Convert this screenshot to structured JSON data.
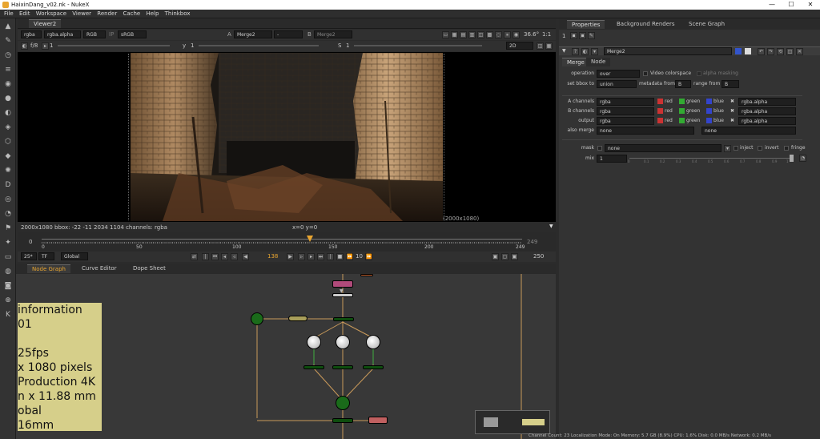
{
  "window": {
    "title": "HaixinDang_v02.nk - NukeX",
    "min": "—",
    "max": "☐",
    "close": "✕"
  },
  "menu": [
    "File",
    "Edit",
    "Workspace",
    "Viewer",
    "Render",
    "Cache",
    "Help",
    "Thinkbox"
  ],
  "viewer": {
    "tab": "Viewer2",
    "channels": "rgba",
    "alpha": "rgba.alpha",
    "colorspace": "RGB",
    "ip": "IP",
    "lut": "sRGB",
    "a_label": "A",
    "a_input": "Merge2",
    "dash": "-",
    "b_label": "B",
    "b_input": "Merge2",
    "zoom": "36.6°",
    "ratio": "1:1",
    "frame_label": "f/8",
    "frame_num": "1",
    "y_label": "y",
    "y_val": "1",
    "s_label": "S",
    "s_val": "1",
    "view_mode": "2D",
    "info": "2000x1080  bbox: -22 -11 2034 1104 channels: rgba",
    "coords": "x=0 y=0",
    "format": "(2000x1080)"
  },
  "timeline": {
    "start": "0",
    "end": "249",
    "ticks": [
      "0",
      "50",
      "100",
      "150",
      "200",
      "249"
    ],
    "current": "138",
    "fps": "25*",
    "tf": "TF",
    "global": "Global",
    "step": "10",
    "last": "250"
  },
  "tabs_bottom": [
    "Node Graph",
    "Curve Editor",
    "Dope Sheet"
  ],
  "sticky": {
    "lines": [
      "information",
      "01",
      "",
      "25fps",
      "x 1080 pixels",
      "Production 4K",
      "n x 11.88 mm",
      "obal",
      "16mm"
    ]
  },
  "properties": {
    "tabs": [
      "Properties",
      "Background Renders",
      "Scene Graph"
    ],
    "count": "1",
    "node_name": "Merge2",
    "subtabs": [
      "Merge",
      "Node"
    ],
    "operation_label": "operation",
    "operation": "over",
    "video_colorspace": "Video colorspace",
    "alpha_masking": "alpha masking",
    "bbox_label": "set bbox to",
    "bbox": "union",
    "metadata_label": "metadata from",
    "metadata": "B",
    "range_label": "range from",
    "range": "B",
    "rows": [
      {
        "label": "A channels",
        "value": "rgba",
        "alpha": "rgba.alpha"
      },
      {
        "label": "B channels",
        "value": "rgba",
        "alpha": "rgba.alpha"
      },
      {
        "label": "output",
        "value": "rgba",
        "alpha": "rgba.alpha"
      }
    ],
    "chan_red": "red",
    "chan_green": "green",
    "chan_blue": "blue",
    "also_merge_label": "also merge",
    "also_merge": "none",
    "also_merge2": "none",
    "mask_label": "mask",
    "mask": "none",
    "inject": "inject",
    "invert": "invert",
    "fringe": "fringe",
    "mix_label": "mix",
    "mix": "1",
    "mix_ticks": [
      "0",
      "0.1",
      "0.2",
      "0.3",
      "0.4",
      "0.5",
      "0.6",
      "0.7",
      "0.8",
      "0.9",
      "1"
    ]
  },
  "status": "Channel Count: 23 Localization Mode: On Memory: 5.7 GB (8.9%) CPU: 1.6% Disk: 0.0 MB/s Network: 0.2 MB/s",
  "colors": {
    "accent": "#e8a530",
    "node_green": "#1a6b1a",
    "wire": "#c99a5a",
    "sticky": "#d6cf8a"
  }
}
